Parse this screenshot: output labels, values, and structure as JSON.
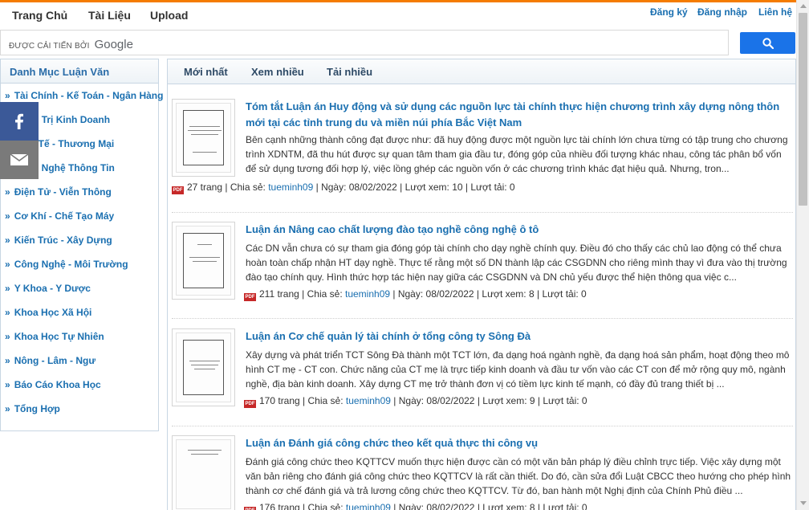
{
  "nav": {
    "home": "Trang Chủ",
    "docs": "Tài Liệu",
    "upload": "Upload",
    "register": "Đăng ký",
    "login": "Đăng nhập",
    "contact": "Liên hệ"
  },
  "search": {
    "powered_by": "ĐƯỢC CẢI TIẾN BỞI",
    "brand": "Google"
  },
  "sidebar": {
    "title": "Danh Mục Luận Văn",
    "items": [
      "Tài Chính - Kế Toán - Ngân Hàng",
      "Quản Trị Kinh Doanh",
      "Kinh Tế - Thương Mại",
      "Công Nghệ Thông Tin",
      "Điện Tử - Viễn Thông",
      "Cơ Khí - Chế Tạo Máy",
      "Kiến Trúc - Xây Dựng",
      "Công Nghệ - Môi Trường",
      "Y Khoa - Y Dược",
      "Khoa Học Xã Hội",
      "Khoa Học Tự Nhiên",
      "Nông - Lâm - Ngư",
      "Báo Cáo Khoa Học",
      "Tổng Hợp"
    ]
  },
  "tabs": [
    "Mới nhất",
    "Xem nhiều",
    "Tải nhiều"
  ],
  "docs": [
    {
      "title": "Tóm tắt Luận án Huy động và sử dụng các nguồn lực tài chính thực hiện chương trình xây dựng nông thôn mới tại các tỉnh trung du và miền núi phía Bắc Việt Nam",
      "desc": "Bên cạnh những thành công đạt được như: đã huy động được một nguồn lực tài chính lớn chưa từng có tập trung cho chương trình XDNTM, đã thu hút được sự quan tâm tham gia đầu tư, đóng góp của nhiều đối tượng khác nhau, công tác phân bổ vốn để sử dụng tương đối hợp lý, việc lồng ghép các nguồn vốn ở các chương trình khác đạt hiệu quả. Nhưng, tron...",
      "pages": "27 trang",
      "share_label": "Chia sẻ:",
      "user": "tueminh09",
      "date": "Ngày: 08/02/2022",
      "views": "Lượt xem: 10",
      "downloads": "Lượt tải: 0"
    },
    {
      "title": "Luận án Nâng cao chất lượng đào tạo nghề công nghệ ô tô",
      "desc": "Các DN vẫn chưa có sự tham gia đóng góp tài chính cho dạy nghề chính quy. Điều đó cho thấy các chủ lao động có thể chưa hoàn toàn chấp nhận HT dạy nghề. Thực tế rằng một số DN thành lập các CSGDNN cho riêng mình thay vì đưa vào thị trường đào tạo chính quy. Hình thức hợp tác hiện nay giữa các CSGDNN và DN chủ yếu được thể hiện thông qua việc c...",
      "pages": "211 trang",
      "share_label": "Chia sẻ:",
      "user": "tueminh09",
      "date": "Ngày: 08/02/2022",
      "views": "Lượt xem: 8",
      "downloads": "Lượt tải: 0"
    },
    {
      "title": "Luận án Cơ chế quản lý tài chính ở tổng công ty Sông Đà",
      "desc": "Xây dựng và phát triển TCT Sông Đà thành một TCT lớn, đa dạng hoá ngành nghề, đa dạng hoá sản phẩm, hoạt động theo mô hình CT mẹ - CT con. Chức năng của CT mẹ là trực tiếp kinh doanh và đầu tư vốn vào các CT con để mở rộng quy mô, ngành nghề, địa bàn kinh doanh. Xây dựng CT mẹ trở thành đơn vị có tiềm lực kinh tế mạnh, có đầy đủ trang thiết bị ...",
      "pages": "170 trang",
      "share_label": "Chia sẻ:",
      "user": "tueminh09",
      "date": "Ngày: 08/02/2022",
      "views": "Lượt xem: 9",
      "downloads": "Lượt tải: 0"
    },
    {
      "title": "Luận án Đánh giá công chức theo kết quả thực thi công vụ",
      "desc": "Đánh giá công chức theo KQTTCV muốn thực hiện được cần có một văn bản pháp lý điều chỉnh trực tiếp. Việc xây dựng một văn bản riêng cho đánh giá công chức theo KQTTCV là rất cần thiết. Do đó, cần sửa đổi Luật CBCC theo hướng cho phép hình thành cơ chế đánh giá và trả lương công chức theo KQTTCV. Từ đó, ban hành một Nghị định của Chính Phủ điều ...",
      "pages": "176 trang",
      "share_label": "Chia sẻ:",
      "user": "tueminh09",
      "date": "Ngày: 08/02/2022",
      "views": "Lượt xem: 8",
      "downloads": "Lượt tải: 0"
    }
  ]
}
